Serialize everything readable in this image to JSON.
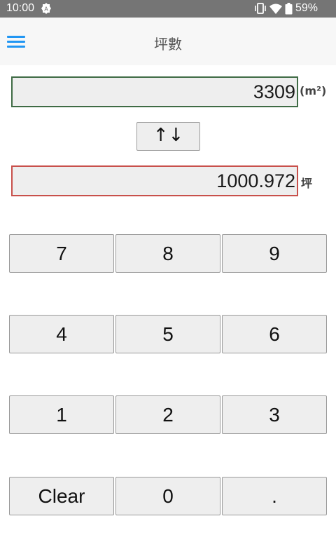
{
  "status_bar": {
    "time": "10:00",
    "battery": "59%",
    "icons": [
      "system-notification-icon",
      "vibrate-icon",
      "wifi-icon",
      "battery-icon"
    ]
  },
  "app_bar": {
    "title": "坪數",
    "menu_icon": "hamburger-menu-icon",
    "accent_color": "#2196f3"
  },
  "converter": {
    "from_value": "3309",
    "from_unit": "(m²)",
    "swap_label": "↑↓",
    "to_value": "1000.972",
    "to_unit": "坪",
    "from_border_color": "#3f6b45",
    "to_border_color": "#c8504b"
  },
  "keypad": {
    "rows": [
      [
        "7",
        "8",
        "9"
      ],
      [
        "4",
        "5",
        "6"
      ],
      [
        "1",
        "2",
        "3"
      ],
      [
        "Clear",
        "0",
        "."
      ]
    ]
  }
}
